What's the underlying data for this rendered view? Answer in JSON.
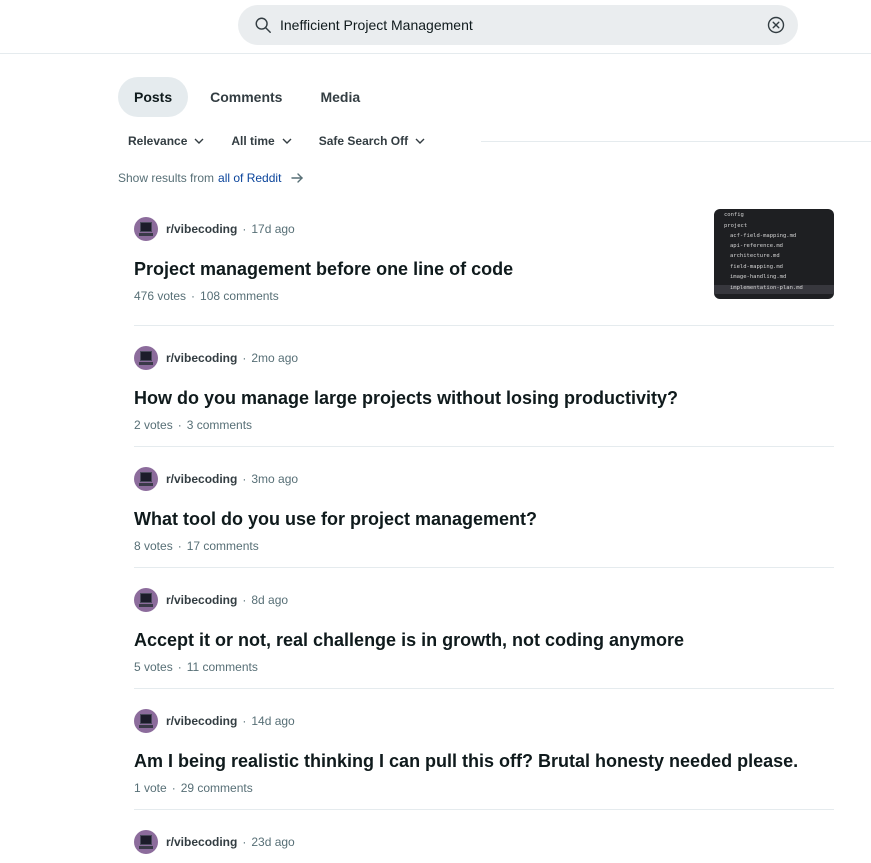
{
  "search": {
    "value": "Inefficient Project Management",
    "search_icon": "search-icon",
    "clear_icon": "clear-circle-x-icon"
  },
  "tabs": [
    {
      "label": "Posts",
      "active": true
    },
    {
      "label": "Comments",
      "active": false
    },
    {
      "label": "Media",
      "active": false
    }
  ],
  "filters": [
    {
      "label": "Relevance",
      "icon": "chevron-down-icon"
    },
    {
      "label": "All time",
      "icon": "chevron-down-icon"
    },
    {
      "label": "Safe Search Off",
      "icon": "chevron-down-icon"
    }
  ],
  "show_results": {
    "prefix": "Show results from",
    "link": "all of Reddit",
    "icon": "arrow-right-icon"
  },
  "thumbnail": {
    "lines": [
      "config",
      "project",
      "acf-field-mapping.md",
      "api-reference.md",
      "architecture.md",
      "field-mapping.md",
      "image-handling.md",
      "implementation-plan.md"
    ]
  },
  "posts": [
    {
      "subreddit": "r/vibecoding",
      "age": "17d ago",
      "title": "Project management before one line of code",
      "votes": "476 votes",
      "comments": "108 comments"
    },
    {
      "subreddit": "r/vibecoding",
      "age": "2mo ago",
      "title": "How do you manage large projects without losing productivity?",
      "votes": "2 votes",
      "comments": "3 comments"
    },
    {
      "subreddit": "r/vibecoding",
      "age": "3mo ago",
      "title": "What tool do you use for project management?",
      "votes": "8 votes",
      "comments": "17 comments"
    },
    {
      "subreddit": "r/vibecoding",
      "age": "8d ago",
      "title": "Accept it or not, real challenge is in growth, not coding anymore",
      "votes": "5 votes",
      "comments": "11 comments"
    },
    {
      "subreddit": "r/vibecoding",
      "age": "14d ago",
      "title": "Am I being realistic thinking I can pull this off? Brutal honesty needed please.",
      "votes": "1 vote",
      "comments": "29 comments"
    },
    {
      "subreddit": "r/vibecoding",
      "age": "23d ago"
    }
  ],
  "colors": {
    "active_tab_bg": "#e5ebee",
    "search_bg": "#eaedef",
    "link": "#0a449b",
    "muted_text": "#576f76"
  }
}
